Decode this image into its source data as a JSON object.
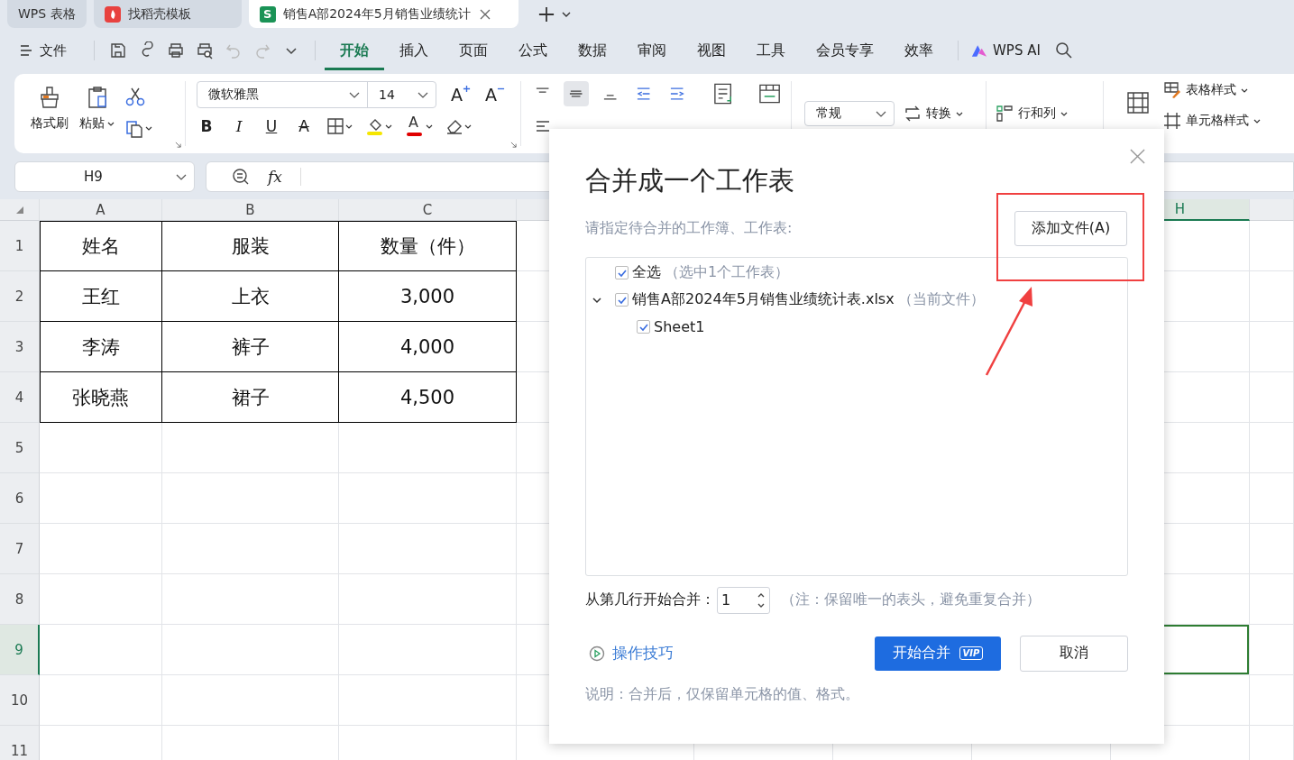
{
  "app_tabs": [
    {
      "label": "WPS 表格",
      "kind": "home",
      "selected": false
    },
    {
      "label": "找稻壳模板",
      "kind": "template",
      "selected": false
    },
    {
      "label": "销售A部2024年5月销售业绩统计",
      "kind": "sheet",
      "badge": "S",
      "selected": true
    }
  ],
  "menu": {
    "file": "文件",
    "tabs": [
      {
        "label": "开始",
        "selected": true
      },
      {
        "label": "插入",
        "selected": false
      },
      {
        "label": "页面",
        "selected": false
      },
      {
        "label": "公式",
        "selected": false
      },
      {
        "label": "数据",
        "selected": false
      },
      {
        "label": "审阅",
        "selected": false
      },
      {
        "label": "视图",
        "selected": false
      },
      {
        "label": "工具",
        "selected": false
      },
      {
        "label": "会员专享",
        "selected": false
      },
      {
        "label": "效率",
        "selected": false
      }
    ],
    "ai": "WPS AI"
  },
  "ribbon": {
    "format_painter": "格式刷",
    "paste": "粘贴",
    "font": "微软雅黑",
    "font_size": "14",
    "size_buttons": [
      {
        "kind": "grow",
        "label": "A"
      },
      {
        "kind": "shrink",
        "label": "A"
      }
    ],
    "style_buttons": [
      {
        "kind": "bold",
        "label": "B"
      },
      {
        "kind": "italic",
        "label": "I"
      },
      {
        "kind": "underline",
        "label": "U"
      },
      {
        "kind": "strike",
        "label": "A"
      }
    ],
    "font_color": "A",
    "number_format": "常规",
    "convert": "转换",
    "rows_cols": "行和列",
    "table_style": "表格样式",
    "cell_style": "单元格样式"
  },
  "name_box": "H9",
  "fx": "fx",
  "sheet": {
    "columns": [
      {
        "label": "A",
        "selected": false
      },
      {
        "label": "B",
        "selected": false
      },
      {
        "label": "C",
        "selected": false
      },
      {
        "label": "H",
        "selected": true
      }
    ],
    "rows": [
      {
        "label": "1",
        "selected": false
      },
      {
        "label": "2",
        "selected": false
      },
      {
        "label": "3",
        "selected": false
      },
      {
        "label": "4",
        "selected": false
      },
      {
        "label": "5",
        "selected": false
      },
      {
        "label": "6",
        "selected": false
      },
      {
        "label": "7",
        "selected": false
      },
      {
        "label": "8",
        "selected": false
      },
      {
        "label": "9",
        "selected": true
      },
      {
        "label": "10",
        "selected": false
      },
      {
        "label": "11",
        "selected": false
      }
    ],
    "cells": [
      [
        "姓名",
        "服装",
        "数量（件）"
      ],
      [
        "王红",
        "上衣",
        "3,000"
      ],
      [
        "李涛",
        "裤子",
        "4,000"
      ],
      [
        "张晓燕",
        "裙子",
        "4,500"
      ]
    ]
  },
  "dialog": {
    "title": "合并成一个工作表",
    "subtitle": "请指定待合并的工作簿、工作表:",
    "add_button": "添加文件(A)",
    "tree": [
      {
        "kind": "all",
        "label": "全选",
        "note": "（选中1个工作表）",
        "checked": true
      },
      {
        "kind": "file",
        "label": "销售A部2024年5月销售业绩统计表.xlsx",
        "note": "（当前文件）",
        "checked": true,
        "expanded": true,
        "children": [
          {
            "label": "Sheet1",
            "checked": true
          }
        ]
      }
    ],
    "start_row_label": "从第几行开始合并：",
    "start_row": "1",
    "start_row_note": "（注：保留唯一的表头，避免重复合并）",
    "tips_link": "操作技巧",
    "merge_button": "开始合并",
    "vip": "VIP",
    "cancel_button": "取消",
    "footnote": "说明：合并后，仅保留单元格的值、格式。"
  }
}
